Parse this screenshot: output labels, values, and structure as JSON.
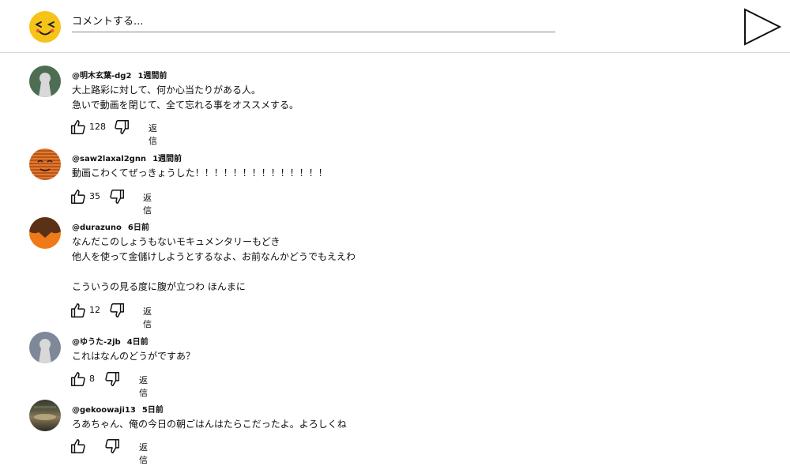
{
  "composer": {
    "placeholder": "コメントする..."
  },
  "comments": [
    {
      "author": "@明木玄葉-dg2",
      "time": "1週間前",
      "text": "大上路彩に対して、何か心当たりがある人。\n急いで動画を閉じて、全て忘れる事をオススメする。",
      "likes": "128",
      "reply": "返信",
      "avatar": "default-avatar-green"
    },
    {
      "author": "@saw2laxal2gnn",
      "time": "1週間前",
      "text": "動画こわくてぜっきょうした！！！！！！！！！！！！！！",
      "likes": "35",
      "reply": "返信",
      "avatar": "striped-face-avatar"
    },
    {
      "author": "@durazuno",
      "time": "6日前",
      "text": "なんだこのしょうもないモキュメンタリーもどき\n他人を使って金儲けしようとするなよ、お前なんかどうでもええわ\n\nこういうの見る度に腹が立つわ ほんまに",
      "likes": "12",
      "reply": "返信",
      "avatar": "orange-brown-avatar"
    },
    {
      "author": "@ゆうた-2jb",
      "time": "4日前",
      "text": "これはなんのどうがですあ？",
      "likes": "8",
      "reply": "返信",
      "avatar": "default-avatar-gray"
    },
    {
      "author": "@gekoowaji13",
      "time": "5日前",
      "text": "ろあちゃん、俺の今日の朝ごはんはたらこだったよ。よろしくね",
      "likes": "",
      "reply": "返信",
      "avatar": "photo-avatar"
    }
  ]
}
